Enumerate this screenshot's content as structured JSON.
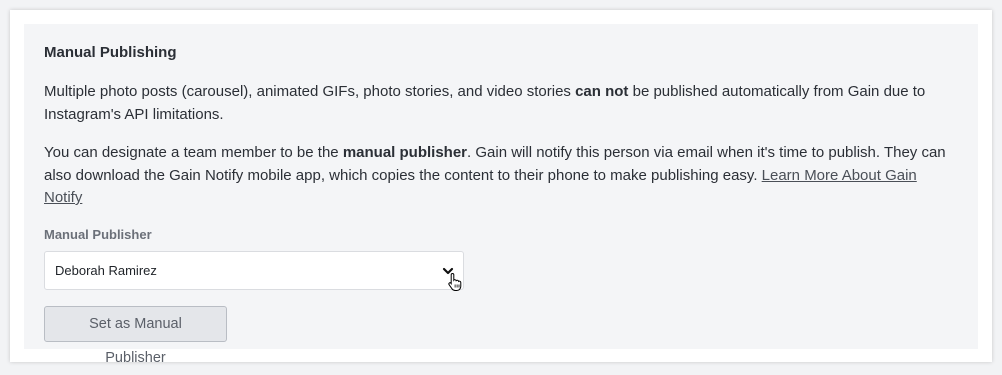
{
  "section": {
    "title": "Manual Publishing",
    "p1_before": "Multiple photo posts (carousel), animated GIFs, photo stories, and video stories ",
    "p1_bold": "can not",
    "p1_after": " be published automatically from Gain due to Instagram's API limitations.",
    "p2_before": "You can designate a team member to be the ",
    "p2_bold": "manual publisher",
    "p2_after": ". Gain will notify this person via email when it's time to publish. They can also download the Gain Notify mobile app, which copies the content to their phone to make publishing easy. ",
    "p2_link": "Learn More About Gain Notify"
  },
  "publisher_field": {
    "label": "Manual Publisher",
    "selected_value": "Deborah Ramirez"
  },
  "actions": {
    "set_button_label": "Set as Manual Publisher"
  },
  "icons": {
    "dropdown": "chevron-down-icon",
    "cursor": "hand-pointer-icon"
  }
}
